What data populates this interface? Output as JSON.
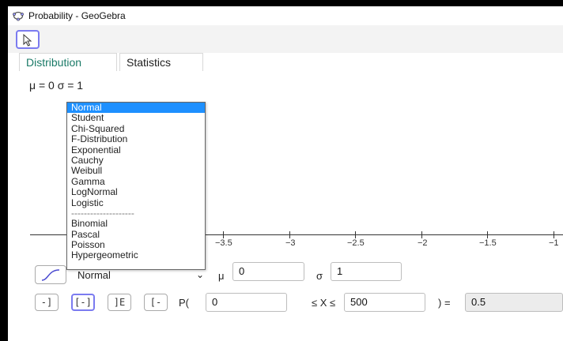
{
  "window": {
    "title": "Probability - GeoGebra"
  },
  "toolbar": {
    "tool_icon": "pointer-icon"
  },
  "tabs": [
    {
      "label": "Distribution",
      "active": true
    },
    {
      "label": "Statistics",
      "active": false
    }
  ],
  "params_label": "μ = 0 σ = 1",
  "axis": {
    "tick_labels": [
      "−3.5",
      "−3",
      "−2.5",
      "−2",
      "−1.5",
      "−1"
    ]
  },
  "dropdown": {
    "items": [
      "Normal",
      "Student",
      "Chi-Squared",
      "F-Distribution",
      "Exponential",
      "Cauchy",
      "Weibull",
      "Gamma",
      "LogNormal",
      "Logistic"
    ],
    "separator": "--------------------",
    "items2": [
      "Binomial",
      "Pascal",
      "Poisson",
      "Hypergeometric"
    ],
    "selected": "Normal"
  },
  "controls": {
    "distribution": "Normal",
    "mu_label": "μ",
    "mu_value": "0",
    "sigma_label": "σ",
    "sigma_value": "1",
    "p_open": "P(",
    "low_value": "0",
    "between": "≤ X ≤",
    "high_value": "500",
    "p_close": ") =",
    "result": "0.5",
    "mode_buttons": [
      "left-sided",
      "interval",
      "two-tailed",
      "right-sided"
    ],
    "accent_color": "#7b7bf0"
  }
}
